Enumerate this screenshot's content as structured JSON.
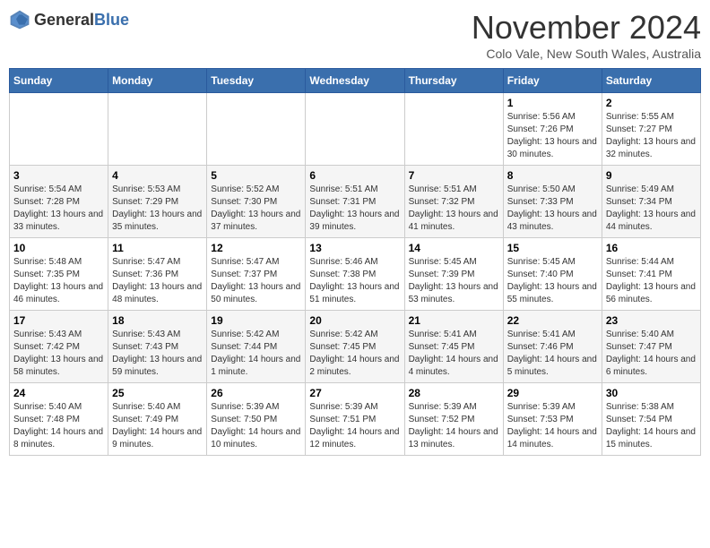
{
  "header": {
    "logo_general": "General",
    "logo_blue": "Blue",
    "month_title": "November 2024",
    "location": "Colo Vale, New South Wales, Australia"
  },
  "weekdays": [
    "Sunday",
    "Monday",
    "Tuesday",
    "Wednesday",
    "Thursday",
    "Friday",
    "Saturday"
  ],
  "weeks": [
    [
      {
        "day": "",
        "sunrise": "",
        "sunset": "",
        "daylight": ""
      },
      {
        "day": "",
        "sunrise": "",
        "sunset": "",
        "daylight": ""
      },
      {
        "day": "",
        "sunrise": "",
        "sunset": "",
        "daylight": ""
      },
      {
        "day": "",
        "sunrise": "",
        "sunset": "",
        "daylight": ""
      },
      {
        "day": "",
        "sunrise": "",
        "sunset": "",
        "daylight": ""
      },
      {
        "day": "1",
        "sunrise": "Sunrise: 5:56 AM",
        "sunset": "Sunset: 7:26 PM",
        "daylight": "Daylight: 13 hours and 30 minutes."
      },
      {
        "day": "2",
        "sunrise": "Sunrise: 5:55 AM",
        "sunset": "Sunset: 7:27 PM",
        "daylight": "Daylight: 13 hours and 32 minutes."
      }
    ],
    [
      {
        "day": "3",
        "sunrise": "Sunrise: 5:54 AM",
        "sunset": "Sunset: 7:28 PM",
        "daylight": "Daylight: 13 hours and 33 minutes."
      },
      {
        "day": "4",
        "sunrise": "Sunrise: 5:53 AM",
        "sunset": "Sunset: 7:29 PM",
        "daylight": "Daylight: 13 hours and 35 minutes."
      },
      {
        "day": "5",
        "sunrise": "Sunrise: 5:52 AM",
        "sunset": "Sunset: 7:30 PM",
        "daylight": "Daylight: 13 hours and 37 minutes."
      },
      {
        "day": "6",
        "sunrise": "Sunrise: 5:51 AM",
        "sunset": "Sunset: 7:31 PM",
        "daylight": "Daylight: 13 hours and 39 minutes."
      },
      {
        "day": "7",
        "sunrise": "Sunrise: 5:51 AM",
        "sunset": "Sunset: 7:32 PM",
        "daylight": "Daylight: 13 hours and 41 minutes."
      },
      {
        "day": "8",
        "sunrise": "Sunrise: 5:50 AM",
        "sunset": "Sunset: 7:33 PM",
        "daylight": "Daylight: 13 hours and 43 minutes."
      },
      {
        "day": "9",
        "sunrise": "Sunrise: 5:49 AM",
        "sunset": "Sunset: 7:34 PM",
        "daylight": "Daylight: 13 hours and 44 minutes."
      }
    ],
    [
      {
        "day": "10",
        "sunrise": "Sunrise: 5:48 AM",
        "sunset": "Sunset: 7:35 PM",
        "daylight": "Daylight: 13 hours and 46 minutes."
      },
      {
        "day": "11",
        "sunrise": "Sunrise: 5:47 AM",
        "sunset": "Sunset: 7:36 PM",
        "daylight": "Daylight: 13 hours and 48 minutes."
      },
      {
        "day": "12",
        "sunrise": "Sunrise: 5:47 AM",
        "sunset": "Sunset: 7:37 PM",
        "daylight": "Daylight: 13 hours and 50 minutes."
      },
      {
        "day": "13",
        "sunrise": "Sunrise: 5:46 AM",
        "sunset": "Sunset: 7:38 PM",
        "daylight": "Daylight: 13 hours and 51 minutes."
      },
      {
        "day": "14",
        "sunrise": "Sunrise: 5:45 AM",
        "sunset": "Sunset: 7:39 PM",
        "daylight": "Daylight: 13 hours and 53 minutes."
      },
      {
        "day": "15",
        "sunrise": "Sunrise: 5:45 AM",
        "sunset": "Sunset: 7:40 PM",
        "daylight": "Daylight: 13 hours and 55 minutes."
      },
      {
        "day": "16",
        "sunrise": "Sunrise: 5:44 AM",
        "sunset": "Sunset: 7:41 PM",
        "daylight": "Daylight: 13 hours and 56 minutes."
      }
    ],
    [
      {
        "day": "17",
        "sunrise": "Sunrise: 5:43 AM",
        "sunset": "Sunset: 7:42 PM",
        "daylight": "Daylight: 13 hours and 58 minutes."
      },
      {
        "day": "18",
        "sunrise": "Sunrise: 5:43 AM",
        "sunset": "Sunset: 7:43 PM",
        "daylight": "Daylight: 13 hours and 59 minutes."
      },
      {
        "day": "19",
        "sunrise": "Sunrise: 5:42 AM",
        "sunset": "Sunset: 7:44 PM",
        "daylight": "Daylight: 14 hours and 1 minute."
      },
      {
        "day": "20",
        "sunrise": "Sunrise: 5:42 AM",
        "sunset": "Sunset: 7:45 PM",
        "daylight": "Daylight: 14 hours and 2 minutes."
      },
      {
        "day": "21",
        "sunrise": "Sunrise: 5:41 AM",
        "sunset": "Sunset: 7:45 PM",
        "daylight": "Daylight: 14 hours and 4 minutes."
      },
      {
        "day": "22",
        "sunrise": "Sunrise: 5:41 AM",
        "sunset": "Sunset: 7:46 PM",
        "daylight": "Daylight: 14 hours and 5 minutes."
      },
      {
        "day": "23",
        "sunrise": "Sunrise: 5:40 AM",
        "sunset": "Sunset: 7:47 PM",
        "daylight": "Daylight: 14 hours and 6 minutes."
      }
    ],
    [
      {
        "day": "24",
        "sunrise": "Sunrise: 5:40 AM",
        "sunset": "Sunset: 7:48 PM",
        "daylight": "Daylight: 14 hours and 8 minutes."
      },
      {
        "day": "25",
        "sunrise": "Sunrise: 5:40 AM",
        "sunset": "Sunset: 7:49 PM",
        "daylight": "Daylight: 14 hours and 9 minutes."
      },
      {
        "day": "26",
        "sunrise": "Sunrise: 5:39 AM",
        "sunset": "Sunset: 7:50 PM",
        "daylight": "Daylight: 14 hours and 10 minutes."
      },
      {
        "day": "27",
        "sunrise": "Sunrise: 5:39 AM",
        "sunset": "Sunset: 7:51 PM",
        "daylight": "Daylight: 14 hours and 12 minutes."
      },
      {
        "day": "28",
        "sunrise": "Sunrise: 5:39 AM",
        "sunset": "Sunset: 7:52 PM",
        "daylight": "Daylight: 14 hours and 13 minutes."
      },
      {
        "day": "29",
        "sunrise": "Sunrise: 5:39 AM",
        "sunset": "Sunset: 7:53 PM",
        "daylight": "Daylight: 14 hours and 14 minutes."
      },
      {
        "day": "30",
        "sunrise": "Sunrise: 5:38 AM",
        "sunset": "Sunset: 7:54 PM",
        "daylight": "Daylight: 14 hours and 15 minutes."
      }
    ]
  ]
}
